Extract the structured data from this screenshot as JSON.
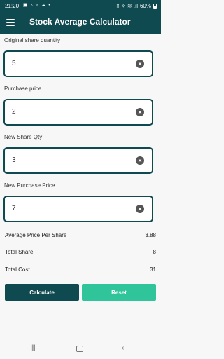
{
  "status": {
    "time": "21:20",
    "icons": "▣ ▵ ♪ ☁ •",
    "right": "▯ ✧ ≋ .ıl",
    "battery": "60%"
  },
  "app": {
    "title": "Stock Average Calculator"
  },
  "fields": [
    {
      "label": "Original share quantity",
      "value": "5"
    },
    {
      "label": "Purchase price",
      "value": "2"
    },
    {
      "label": "New Share Qty",
      "value": "3"
    },
    {
      "label": "New Purchase Price",
      "value": "7"
    }
  ],
  "results": [
    {
      "label": "Average Price Per Share",
      "value": "3.88"
    },
    {
      "label": "Total Share",
      "value": "8"
    },
    {
      "label": "Total Cost",
      "value": "31"
    }
  ],
  "buttons": {
    "calculate": "Calculate",
    "reset": "Reset"
  },
  "nav": {
    "recent": "|||",
    "back": "‹"
  },
  "colors": {
    "primary": "#0e4a50",
    "accent": "#2fc49a"
  }
}
